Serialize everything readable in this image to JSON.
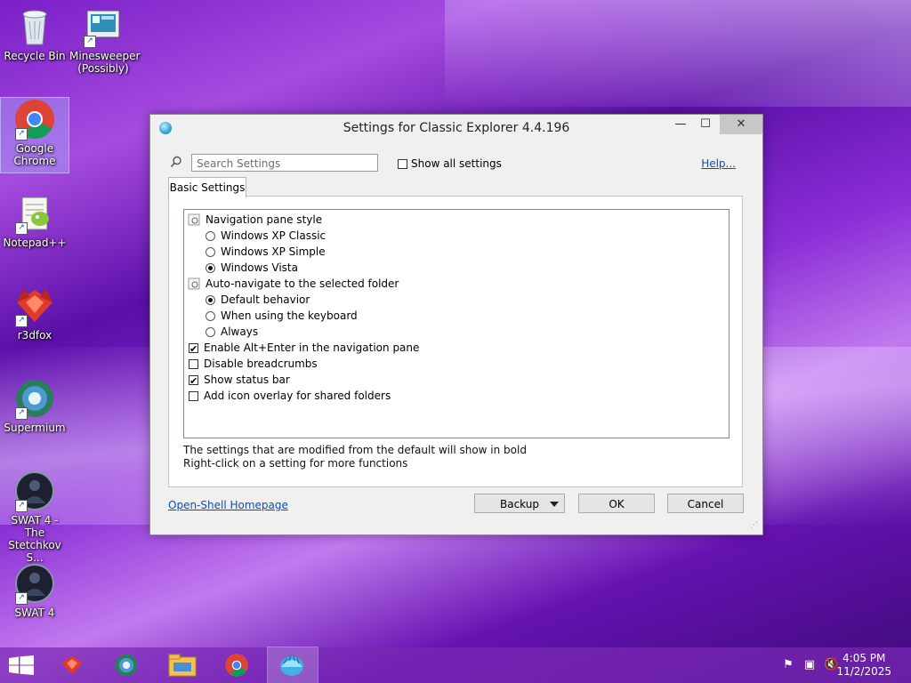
{
  "desktop": {
    "icons": [
      {
        "label": "Recycle Bin",
        "icon": "recycle-bin-icon"
      },
      {
        "label": "Minesweeper (Possibly)",
        "icon": "minesweeper-icon"
      },
      {
        "label": "Google Chrome",
        "icon": "chrome-icon"
      },
      {
        "label": "Notepad++",
        "icon": "notepad-plus-plus-icon"
      },
      {
        "label": "r3dfox",
        "icon": "r3dfox-icon"
      },
      {
        "label": "Supermium",
        "icon": "supermium-icon"
      },
      {
        "label": "SWAT 4 - The Stetchkov S...",
        "icon": "swat4-tss-icon"
      },
      {
        "label": "SWAT 4",
        "icon": "swat4-icon"
      }
    ]
  },
  "dialog": {
    "title": "Settings for Classic Explorer 4.4.196",
    "window_controls": {
      "minimize": "—",
      "maximize": "☐",
      "close": "✕"
    },
    "search_placeholder": "Search Settings",
    "show_all_label": "Show all settings",
    "show_all_checked": false,
    "help_link": "Help...",
    "tab_label": "Basic Settings",
    "settings": {
      "nav_pane_style": {
        "label": "Navigation pane style",
        "options": [
          "Windows XP Classic",
          "Windows XP Simple",
          "Windows Vista"
        ],
        "selected": "Windows Vista"
      },
      "auto_navigate": {
        "label": "Auto-navigate to the selected folder",
        "options": [
          "Default behavior",
          "When using the keyboard",
          "Always"
        ],
        "selected": "Default behavior"
      },
      "checkboxes": [
        {
          "label": "Enable Alt+Enter in the navigation pane",
          "checked": true
        },
        {
          "label": "Disable breadcrumbs",
          "checked": false
        },
        {
          "label": "Show status bar",
          "checked": true
        },
        {
          "label": "Add icon overlay for shared folders",
          "checked": false
        }
      ]
    },
    "info_line_1": "The settings that are modified from the default will show in bold",
    "info_line_2": "Right-click on a setting for more functions",
    "homepage_link": "Open-Shell Homepage",
    "buttons": {
      "backup": "Backup",
      "ok": "OK",
      "cancel": "Cancel"
    }
  },
  "taskbar": {
    "pinned": [
      "start-icon",
      "r3dfox-icon",
      "supermium-icon",
      "file-explorer-icon",
      "chrome-icon",
      "classic-explorer-settings-icon"
    ],
    "active": "classic-explorer-settings-icon",
    "clock": {
      "time": "4:05 PM",
      "date": "11/2/2025"
    }
  },
  "colors": {
    "accent": "#7a1fc7",
    "link": "#0a4fb8",
    "close_button": "#c7c7c7"
  }
}
